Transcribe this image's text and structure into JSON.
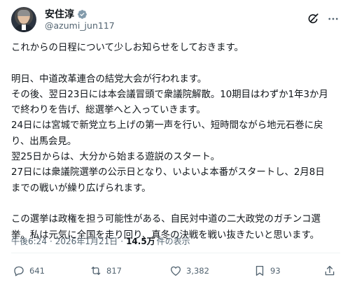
{
  "author": {
    "display_name": "安住淳",
    "handle": "@azumi_jun117",
    "verified": true
  },
  "post": {
    "lines": [
      "これからの日程について少しお知らせをしておきます。",
      "",
      "明日、中道改革連合の結党大会が行われます。",
      "その後、翌日23日には本会議冒頭で衆議院解散。10期目はわずか1年3か月",
      "で終わりを告げ、総選挙へと入っていきます。",
      "24日には宮城で新党立ち上げの第一声を行い、短時間ながら地元石巻に戻",
      "り、出馬会見。",
      "翌25日からは、大分から始まる遊説のスタート。",
      "27日には衆議院選挙の公示日となり、いよいよ本番がスタートし、2月8日",
      "までの戦いが繰り広げられます。",
      "",
      "この選挙は政権を担う可能性がある、自民対中道の二大政党のガチンコ選",
      "挙。私は元気に全国を走り回り、真冬の決戦を戦い抜きたいと思います。"
    ]
  },
  "meta": {
    "time": "午後6:24",
    "separator": "·",
    "date": "2026年1月21日",
    "views_count": "14.5万",
    "views_label": "件の表示"
  },
  "actions": {
    "replies": "641",
    "reposts": "817",
    "likes": "3,382",
    "bookmarks": "93"
  },
  "icons": {
    "grok": "grok-icon",
    "more": "more-icon",
    "reply": "reply-icon",
    "repost": "repost-icon",
    "like": "heart-icon",
    "bookmark": "bookmark-icon",
    "share": "share-icon"
  },
  "colors": {
    "text": "#0f1419",
    "secondary": "#536471",
    "verified": "#1d9bf0"
  }
}
